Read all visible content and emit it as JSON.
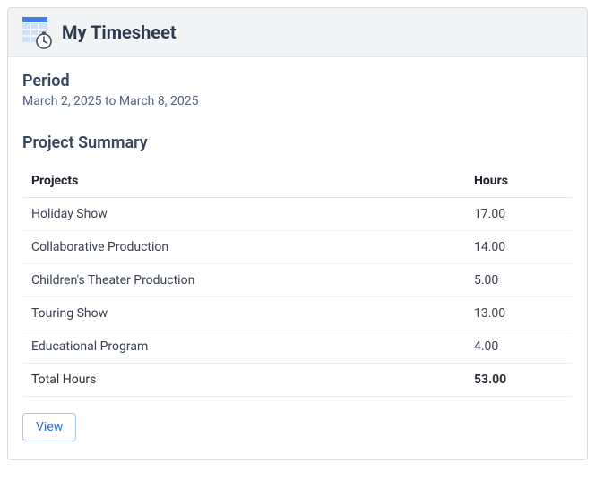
{
  "header": {
    "title": "My Timesheet"
  },
  "period": {
    "heading": "Period",
    "range_text": "March 2, 2025 to March 8, 2025"
  },
  "summary": {
    "heading": "Project Summary",
    "columns": {
      "project": "Projects",
      "hours": "Hours"
    },
    "rows": [
      {
        "project": "Holiday Show",
        "hours": "17.00"
      },
      {
        "project": "Collaborative Production",
        "hours": "14.00"
      },
      {
        "project": "Children's Theater Production",
        "hours": "5.00"
      },
      {
        "project": "Touring Show",
        "hours": "13.00"
      },
      {
        "project": "Educational Program",
        "hours": "4.00"
      }
    ],
    "total": {
      "label": "Total Hours",
      "value": "53.00"
    }
  },
  "actions": {
    "view_label": "View"
  }
}
